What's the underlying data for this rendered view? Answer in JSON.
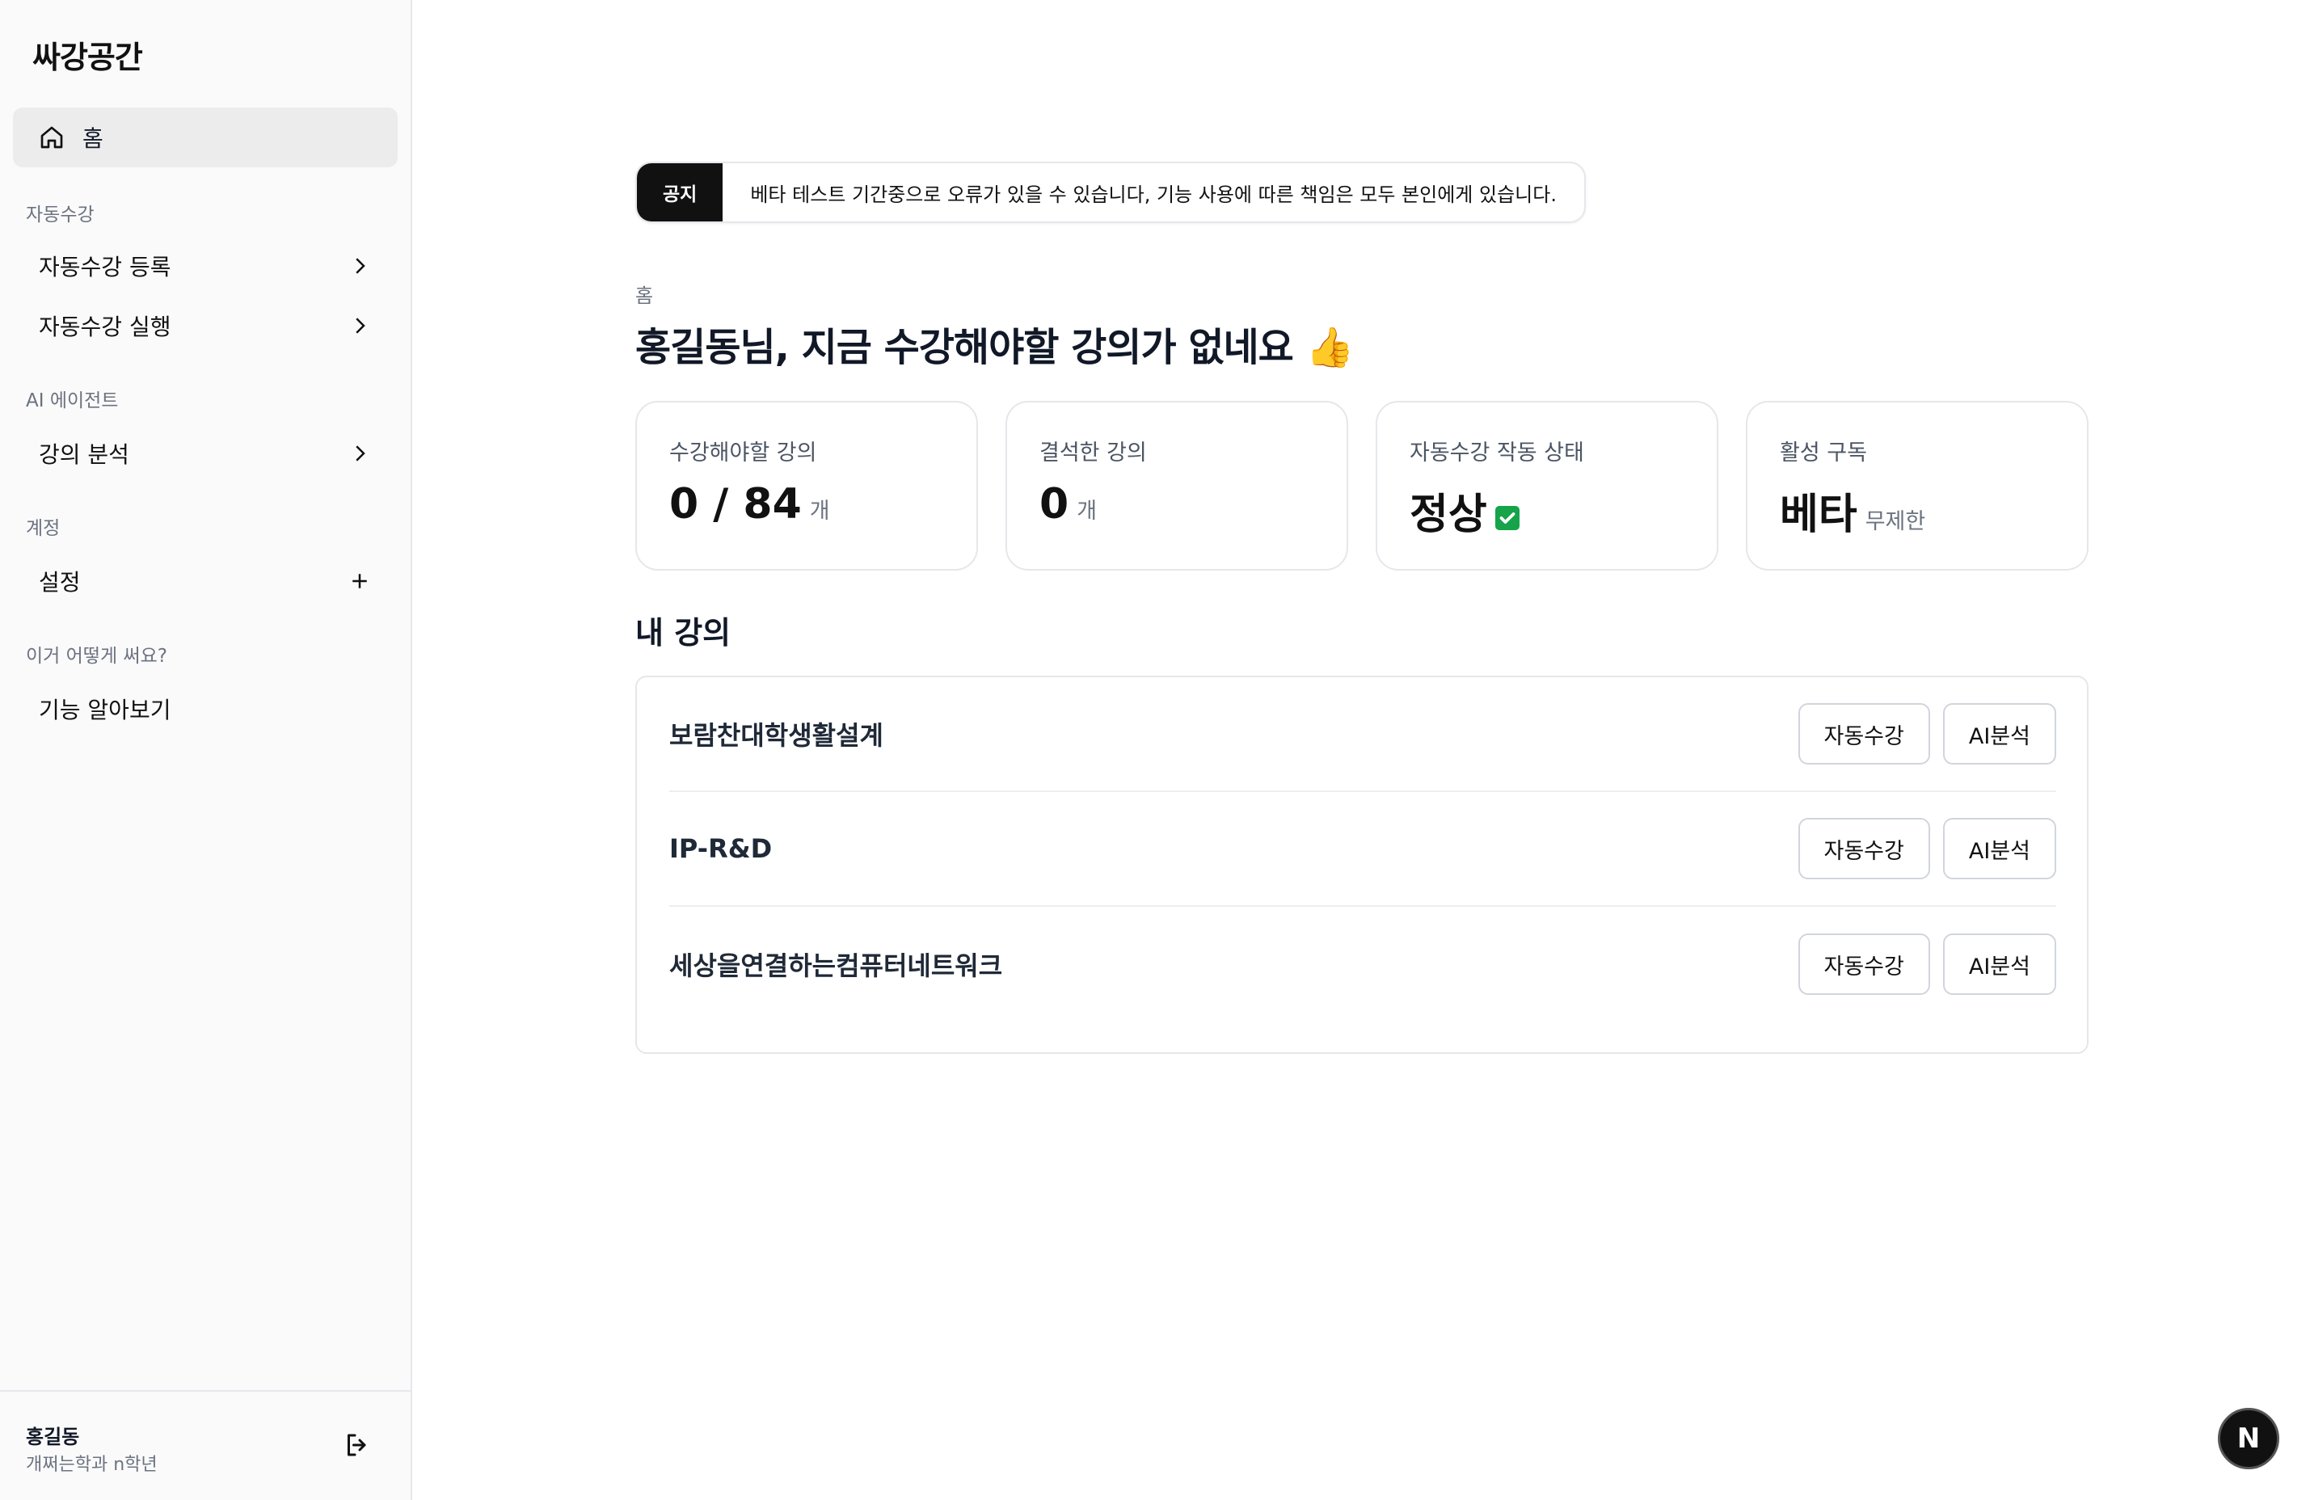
{
  "app": {
    "logo": "싸강공간"
  },
  "sidebar": {
    "home_label": "홈",
    "sections": [
      {
        "label": "자동수강",
        "items": [
          {
            "label": "자동수강 등록",
            "icon": "chevron-right-icon"
          },
          {
            "label": "자동수강 실행",
            "icon": "chevron-right-icon"
          }
        ]
      },
      {
        "label": "AI 에이전트",
        "items": [
          {
            "label": "강의 분석",
            "icon": "chevron-right-icon"
          }
        ]
      },
      {
        "label": "계정",
        "items": [
          {
            "label": "설정",
            "icon": "plus-icon"
          }
        ]
      },
      {
        "label": "이거 어떻게 써요?",
        "items": [
          {
            "label": "기능 알아보기"
          }
        ]
      }
    ],
    "user": {
      "name": "홍길동",
      "dept": "개쩌는학과 n학년"
    }
  },
  "notice": {
    "badge": "공지",
    "text": "베타 테스트 기간중으로 오류가 있을 수 있습니다, 기능 사용에 따른 책임은 모두 본인에게 있습니다."
  },
  "page": {
    "breadcrumb": "홈",
    "title": "홍길동님, 지금 수강해야할 강의가 없네요 👍"
  },
  "stats": [
    {
      "label": "수강해야할 강의",
      "value": "0 / 84",
      "unit": "개"
    },
    {
      "label": "결석한 강의",
      "value": "0",
      "unit": "개"
    },
    {
      "label": "자동수강 작동 상태",
      "value": "정상",
      "unit": ""
    },
    {
      "label": "활성 구독",
      "value": "베타",
      "unit": "무제한"
    }
  ],
  "courses": {
    "title": "내 강의",
    "auto_label": "자동수강",
    "ai_label": "AI분석",
    "items": [
      {
        "name": "보람찬대학생활설계"
      },
      {
        "name": "IP-R&D"
      },
      {
        "name": "세상을연결하는컴퓨터네트워크"
      }
    ]
  },
  "floating": {
    "badge": "N"
  },
  "colors": {
    "accent": "#111111",
    "border": "#e5e7eb",
    "success": "#16a34a"
  }
}
